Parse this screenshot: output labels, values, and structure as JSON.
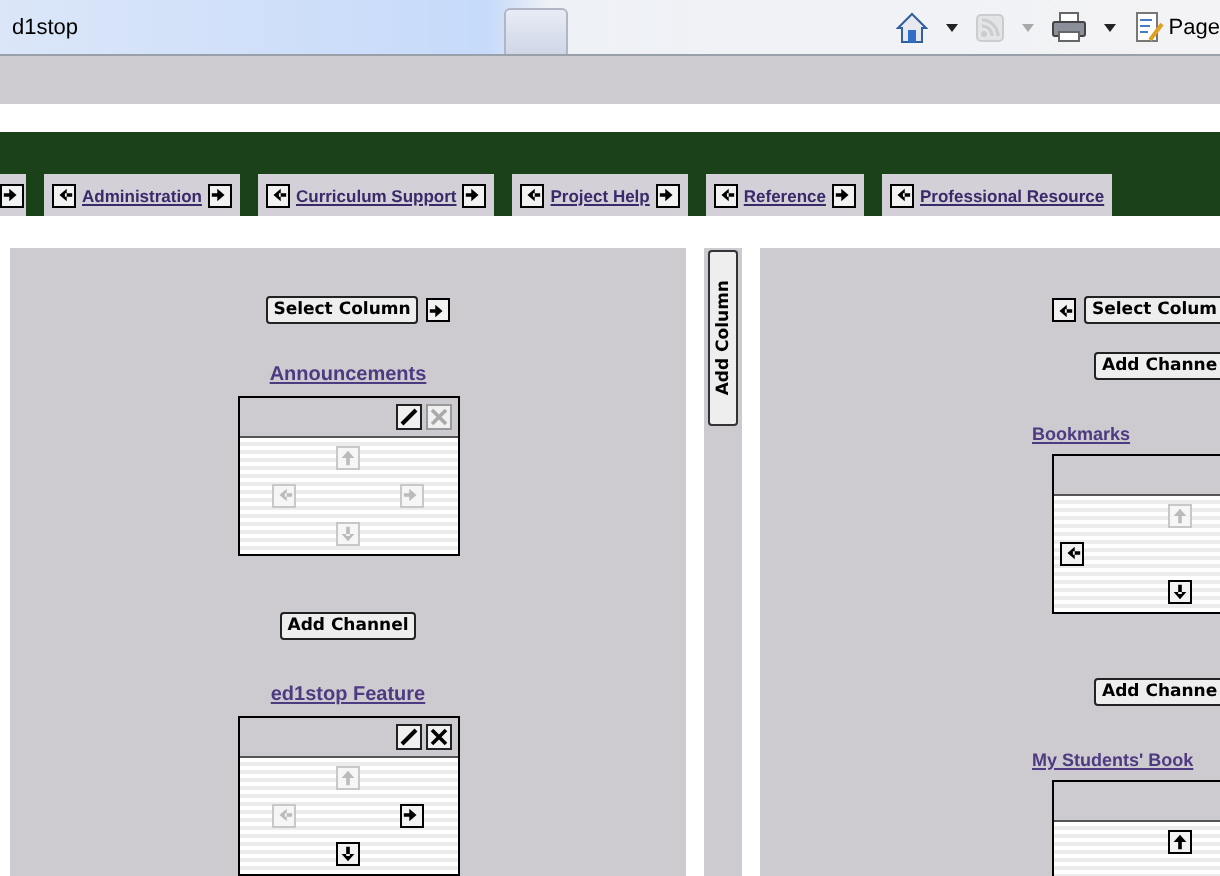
{
  "browser": {
    "title": "d1stop",
    "toolbar": [
      {
        "kind": "home",
        "disabled": false
      },
      {
        "kind": "dropdown",
        "disabled": false
      },
      {
        "kind": "feed",
        "disabled": true
      },
      {
        "kind": "dropdown",
        "disabled": true
      },
      {
        "kind": "print",
        "disabled": false
      },
      {
        "kind": "dropdown",
        "disabled": false
      },
      {
        "kind": "page",
        "disabled": false,
        "label": "Page"
      }
    ]
  },
  "tabs": [
    {
      "left_arrow": false,
      "right_arrow": true
    },
    {
      "label": "Administration",
      "left_arrow": true,
      "right_arrow": true
    },
    {
      "label": "Curriculum Support",
      "left_arrow": true,
      "right_arrow": true
    },
    {
      "label": "Project Help",
      "left_arrow": true,
      "right_arrow": true
    },
    {
      "label": "Reference",
      "left_arrow": true,
      "right_arrow": true
    },
    {
      "label": "Professional Resource",
      "left_arrow": true,
      "right_arrow": false
    }
  ],
  "add_column": "Add Column",
  "columns": [
    {
      "items": [
        {
          "kind": "select",
          "label": "Select Column",
          "left_arrow": false,
          "right_arrow": true
        },
        {
          "kind": "channel",
          "title": "Announcements",
          "controls": [
            {
              "kind": "edit",
              "disabled": false
            },
            {
              "kind": "close",
              "disabled": true
            }
          ],
          "arrows": [
            {
              "kind": "up",
              "disabled": true
            },
            {
              "kind": "left",
              "disabled": true
            },
            {
              "kind": "right",
              "disabled": true
            },
            {
              "kind": "down",
              "disabled": true
            }
          ]
        },
        {
          "kind": "add",
          "label": "Add Channel"
        },
        {
          "kind": "channel",
          "title": "ed1stop Feature",
          "controls": [
            {
              "kind": "edit",
              "disabled": false
            },
            {
              "kind": "close",
              "disabled": false
            }
          ],
          "arrows": [
            {
              "kind": "up",
              "disabled": true
            },
            {
              "kind": "left",
              "disabled": true
            },
            {
              "kind": "right",
              "disabled": false
            },
            {
              "kind": "down",
              "disabled": false
            }
          ]
        }
      ]
    },
    {
      "items": [
        {
          "kind": "select",
          "label": "Select Colum",
          "left_arrow": true,
          "right_arrow": false
        },
        {
          "kind": "add",
          "label": "Add Channe"
        },
        {
          "kind": "channel",
          "title": "Bookmarks",
          "arrows": [
            {
              "kind": "up",
              "disabled": true
            },
            {
              "kind": "left",
              "disabled": false
            },
            {
              "kind": "down",
              "disabled": false
            }
          ]
        },
        {
          "kind": "add",
          "label": "Add Channe"
        },
        {
          "kind": "channel",
          "title": "My Students' Book",
          "arrows": [
            {
              "kind": "up",
              "disabled": false
            }
          ]
        }
      ]
    }
  ]
}
